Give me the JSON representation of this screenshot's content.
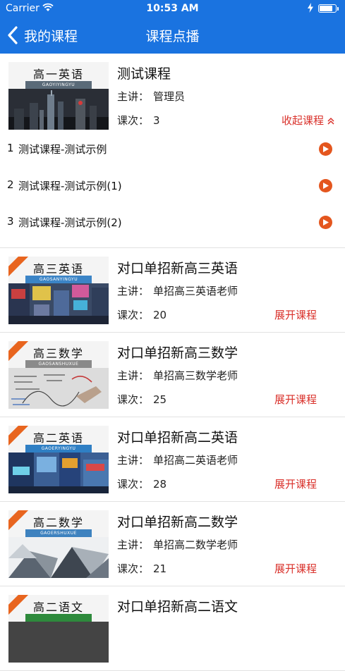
{
  "status_bar": {
    "carrier": "Carrier",
    "time": "10:53 AM",
    "battery_level": 0.8
  },
  "nav": {
    "back_label": "我的课程",
    "title": "课程点播"
  },
  "courses": [
    {
      "title": "测试课程",
      "teacher_label": "主讲：",
      "teacher": "管理员",
      "count_label": "课次：",
      "count": "3",
      "toggle_label": "收起课程",
      "expanded": true,
      "thumb": {
        "title": "高一英语",
        "pinyin": "GAOYIYINGYU",
        "band_color": "#5a6a78"
      },
      "lessons": [
        {
          "num": "1",
          "name": "测试课程-测试示例"
        },
        {
          "num": "2",
          "name": "测试课程-测试示例(1)"
        },
        {
          "num": "3",
          "name": "测试课程-测试示例(2)"
        }
      ]
    },
    {
      "title": "对口单招新高三英语",
      "teacher_label": "主讲：",
      "teacher": "单招高三英语老师",
      "count_label": "课次：",
      "count": "20",
      "toggle_label": "展开课程",
      "thumb": {
        "title": "高三英语",
        "pinyin": "GAOSANYINGYU",
        "band_color": "#3b84c6"
      }
    },
    {
      "title": "对口单招新高三数学",
      "teacher_label": "主讲：",
      "teacher": "单招高三数学老师",
      "count_label": "课次：",
      "count": "25",
      "toggle_label": "展开课程",
      "thumb": {
        "title": "高三数学",
        "pinyin": "GAOSANSHUXUE",
        "band_color": "#8a8a8a"
      }
    },
    {
      "title": "对口单招新高二英语",
      "teacher_label": "主讲：",
      "teacher": "单招高二英语老师",
      "count_label": "课次：",
      "count": "28",
      "toggle_label": "展开课程",
      "thumb": {
        "title": "高二英语",
        "pinyin": "GAOERYINGYU",
        "band_color": "#2f7fc4"
      }
    },
    {
      "title": "对口单招新高二数学",
      "teacher_label": "主讲：",
      "teacher": "单招高二数学老师",
      "count_label": "课次：",
      "count": "21",
      "toggle_label": "展开课程",
      "thumb": {
        "title": "高二数学",
        "pinyin": "GAOERSHUXUE",
        "band_color": "#3e82bf"
      }
    },
    {
      "title": "对口单招新高二语文",
      "thumb": {
        "title": "高二语文",
        "pinyin": "",
        "band_color": "#2e8a3c"
      }
    }
  ],
  "colors": {
    "nav_bg": "#1a73e0",
    "accent_red": "#d9302a",
    "play_orange": "#e4561e"
  },
  "icons": {
    "back": "chevron-left-icon",
    "play": "play-circle-icon",
    "collapse": "double-chevron-up-icon",
    "wifi": "wifi-icon",
    "battery": "battery-icon"
  }
}
